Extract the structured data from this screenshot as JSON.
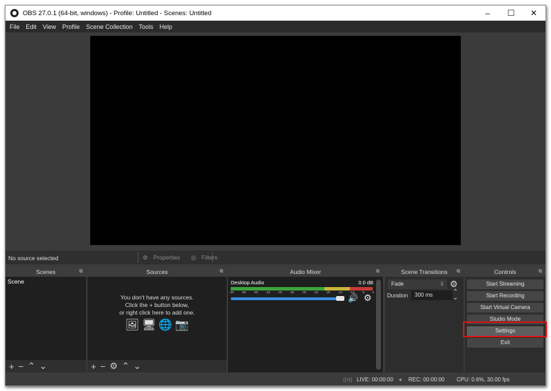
{
  "window": {
    "title": "OBS 27.0.1 (64-bit, windows) - Profile: Untitled - Scenes: Untitled",
    "controls": {
      "minimize": "–",
      "maximize": "☐",
      "close": "✕"
    }
  },
  "menu": [
    "File",
    "Edit",
    "View",
    "Profile",
    "Scene Collection",
    "Tools",
    "Help"
  ],
  "source_bar": {
    "status": "No source selected",
    "properties_label": "Properties",
    "filters_label": "Filters"
  },
  "docks": {
    "scenes": {
      "title": "Scenes",
      "items": [
        "Scene"
      ]
    },
    "sources": {
      "title": "Sources",
      "empty_lines": [
        "You don't have any sources.",
        "Click the + button below,",
        "or right click here to add one."
      ]
    },
    "mixer": {
      "title": "Audio Mixer",
      "channel": {
        "name": "Desktop Audio",
        "level": "0.0 dB",
        "volume_fraction": 1.0
      },
      "ticks": [
        "-60",
        "-55",
        "-50",
        "-45",
        "-40",
        "-35",
        "-30",
        "-25",
        "-20",
        "-15",
        "-10",
        "-5",
        "0"
      ],
      "colors": {
        "green": "#3aa53a",
        "yellow": "#c8b43a",
        "red": "#c83a3a",
        "volume": "#3a8ee6"
      }
    },
    "transitions": {
      "title": "Scene Transitions",
      "selected": "Fade",
      "duration_label": "Duration",
      "duration_value": "300 ms"
    },
    "controls": {
      "title": "Controls",
      "buttons": [
        "Start Streaming",
        "Start Recording",
        "Start Virtual Camera",
        "Studio Mode",
        "Settings",
        "Exit"
      ],
      "highlighted": "Settings",
      "highlight_color": "#e01010"
    }
  },
  "status": {
    "live": "LIVE: 00:00:00",
    "rec": "REC: 00:00:00",
    "cpu": "CPU: 0.6%, 30.00 fps"
  }
}
